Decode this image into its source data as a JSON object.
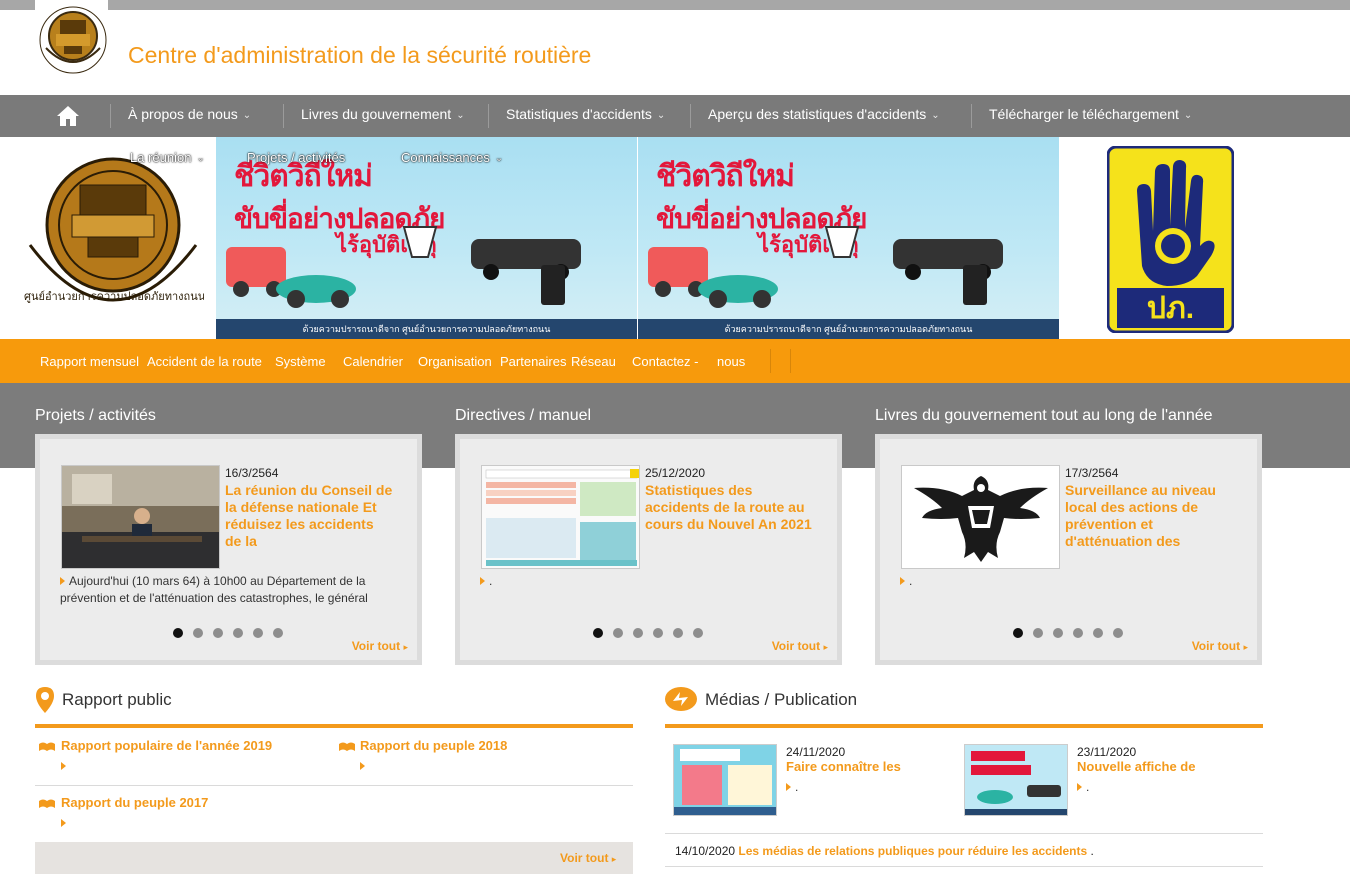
{
  "header": {
    "site_title": "Centre d'administration de la sécurité routière",
    "colors": {
      "accent": "#f39a1c",
      "nav_bg": "#7a7a7a",
      "orange_bar": "#f79a0c",
      "grey_band": "#7c7c7c"
    }
  },
  "nav": {
    "home_icon": "home-icon",
    "items": [
      "À propos de nous",
      "Livres du gouvernement",
      "Statistiques d'accidents",
      "Aperçu des statistiques d'accidents",
      "Télécharger le téléchargement"
    ],
    "submenu": [
      "La réunion",
      "Projets / activités",
      "Connaissances"
    ]
  },
  "banner": {
    "thai_line1": "ชีวิตวิถีใหม่",
    "thai_line2": "ขับขี่อย่างปลอดภัย",
    "thai_line3": "ไร้อุบัติเหตุ",
    "footer": "ด้วยความปรารถนาดีจาก ศูนย์อำนวยการความปลอดภัยทางถนน",
    "logo_left_text": "ศูนย์อำนวยการความปลอดภัยทางถนน",
    "logo_right_text": "ปภ."
  },
  "quicklinks": [
    "Rapport mensuel",
    "Accident de la route",
    "Système",
    "Calendrier",
    "Organisation",
    "Partenaires",
    "Réseau",
    "Contactez -",
    "nous"
  ],
  "sections": [
    {
      "title": "Projets / activités",
      "date": "16/3/2564",
      "headline": "La réunion du Conseil de la défense nationale Et réduisez les accidents de la",
      "excerpt": "Aujourd'hui (10 mars 64) à 10h00 au Département de la prévention et de l'atténuation des catastrophes, le général",
      "more": "Voir tout"
    },
    {
      "title": "Directives / manuel",
      "date": "25/12/2020",
      "headline": "Statistiques des accidents de la route au cours du Nouvel An 2021",
      "excerpt": ".",
      "more": "Voir tout"
    },
    {
      "title": "Livres du gouvernement tout au long de l'année",
      "date": "17/3/2564",
      "headline": "Surveillance au niveau local des actions de prévention et d'atténuation des",
      "excerpt": ".",
      "more": "Voir tout"
    }
  ],
  "public_report": {
    "title": "Rapport public",
    "items": [
      "Rapport populaire de l'année 2019",
      "Rapport du peuple 2018",
      "Rapport du peuple 2017"
    ],
    "more": "Voir tout"
  },
  "media": {
    "title": "Médias / Publication",
    "items": [
      {
        "date": "24/11/2020",
        "headline": "Faire connaître les",
        "excerpt": "."
      },
      {
        "date": "23/11/2020",
        "headline": "Nouvelle affiche de",
        "excerpt": "."
      }
    ],
    "row": {
      "date": "14/10/2020",
      "headline": "Les médias de relations publiques pour réduire les accidents",
      "tail": "."
    }
  }
}
